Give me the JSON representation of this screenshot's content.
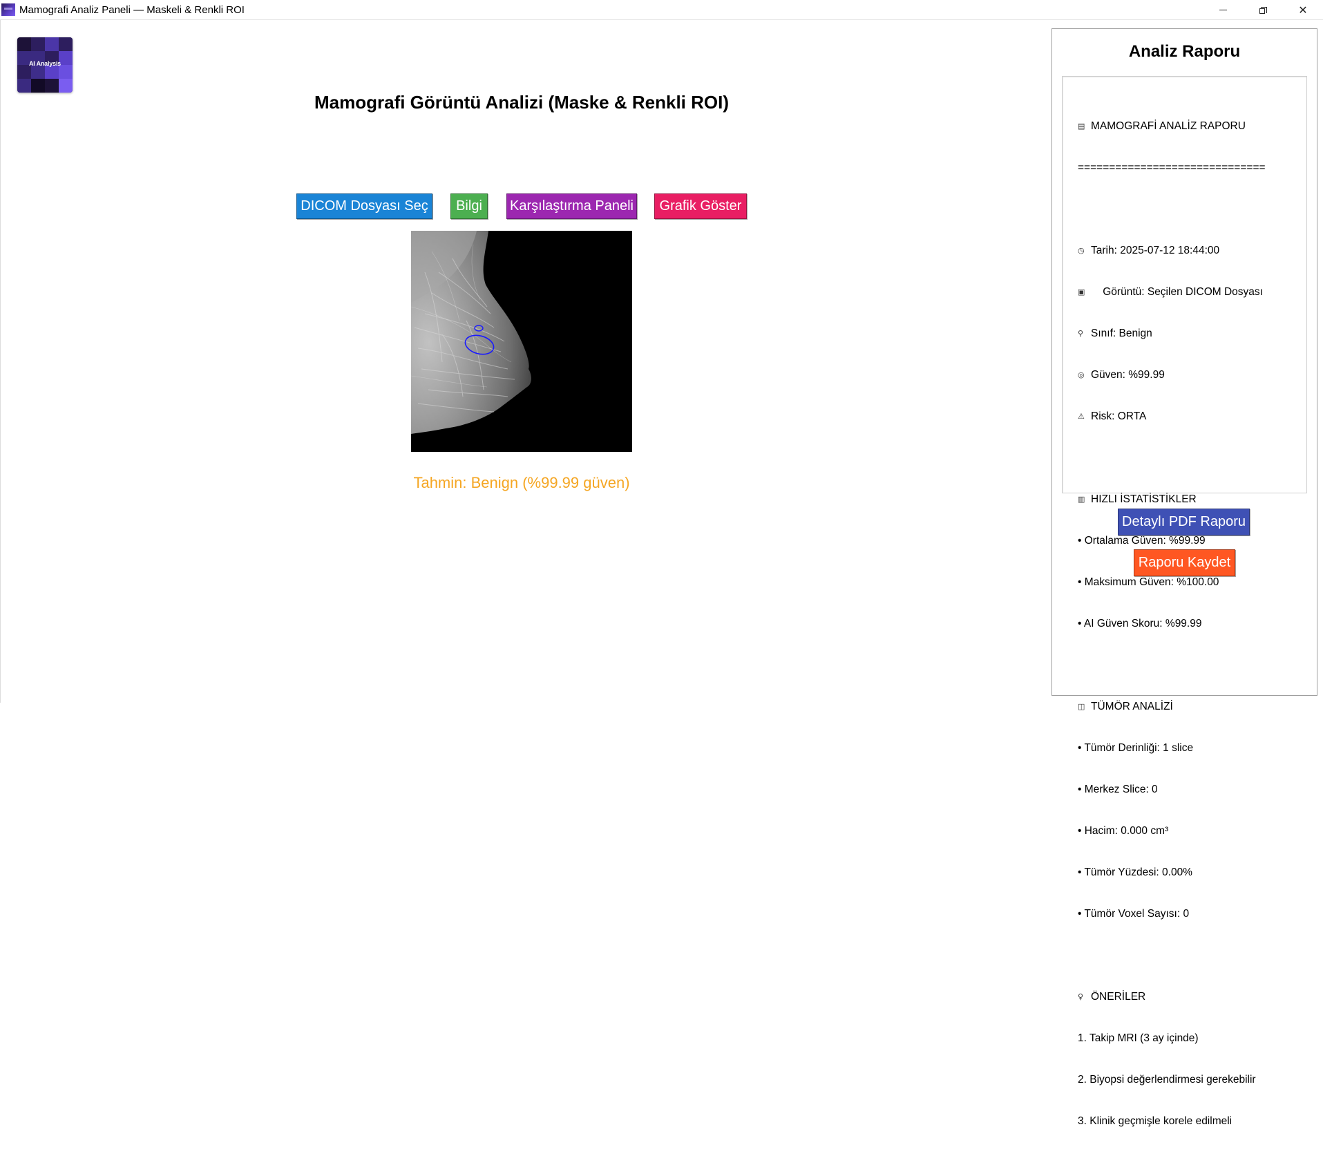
{
  "window": {
    "title": "Mamografi Analiz Paneli — Maskeli & Renkli ROI",
    "controls": [
      "minimize",
      "restore",
      "close"
    ]
  },
  "logo": {
    "text": "AI Analysis",
    "icon": "ai-analysis-logo"
  },
  "header": {
    "title": "Mamografi Görüntü Analizi (Maske & Renkli ROI)"
  },
  "toolbar": {
    "dicom_label": "DICOM Dosyası Seç",
    "info_label": "Bilgi",
    "compare_label": "Karşılaştırma Paneli",
    "chart_label": "Grafik Göster",
    "colors": {
      "dicom": "#1a84d6",
      "info": "#4caf50",
      "compare": "#9c27b0",
      "chart": "#e91e63"
    }
  },
  "viewer": {
    "image": "mammogram-with-roi-contour",
    "roi_color": "#1a1aff",
    "prediction": "Tahmin: Benign (%99.99 güven)",
    "prediction_color": "#f5a623"
  },
  "report": {
    "heading": "Analiz Raporu",
    "title_line": "MAMOGRAFİ ANALİZ RAPORU",
    "separator": "==============================",
    "date": "Tarih: 2025-07-12 18:44:00",
    "image": "Görüntü: Seçilen DICOM Dosyası",
    "class": "Sınıf: Benign",
    "confidence": "Güven: %99.99",
    "risk": "Risk: ORTA",
    "stats_title": "HIZLI İSTATİSTİKLER",
    "stats": [
      "• Ortalama Güven: %99.99",
      "• Maksimum Güven: %100.00",
      "• AI Güven Skoru: %99.99"
    ],
    "tumor_title": "TÜMÖR ANALİZİ",
    "tumor": [
      "• Tümör Derinliği: 1 slice",
      "• Merkez Slice: 0",
      "• Hacim: 0.000 cm³",
      "• Tümör Yüzdesi: 0.00%",
      "• Tümör Voxel Sayısı: 0"
    ],
    "rec_title": "ÖNERİLER",
    "recommendations": [
      "1. Takip MRI (3 ay içinde)",
      "2. Biyopsi değerlendirmesi gerekebilir",
      "3. Klinik geçmişle korele edilmeli"
    ],
    "icons": {
      "title": "clipboard-icon",
      "date": "clock-icon",
      "image": "image-icon",
      "class": "magnifier-icon",
      "confidence": "target-icon",
      "risk": "warning-icon",
      "stats": "bar-chart-icon",
      "tumor": "chart-icon",
      "rec": "lightbulb-icon"
    },
    "pdf_label": "Detaylı PDF Raporu",
    "save_label": "Raporu Kaydet",
    "pdf_color": "#3f51b5",
    "save_color": "#ff5722"
  }
}
